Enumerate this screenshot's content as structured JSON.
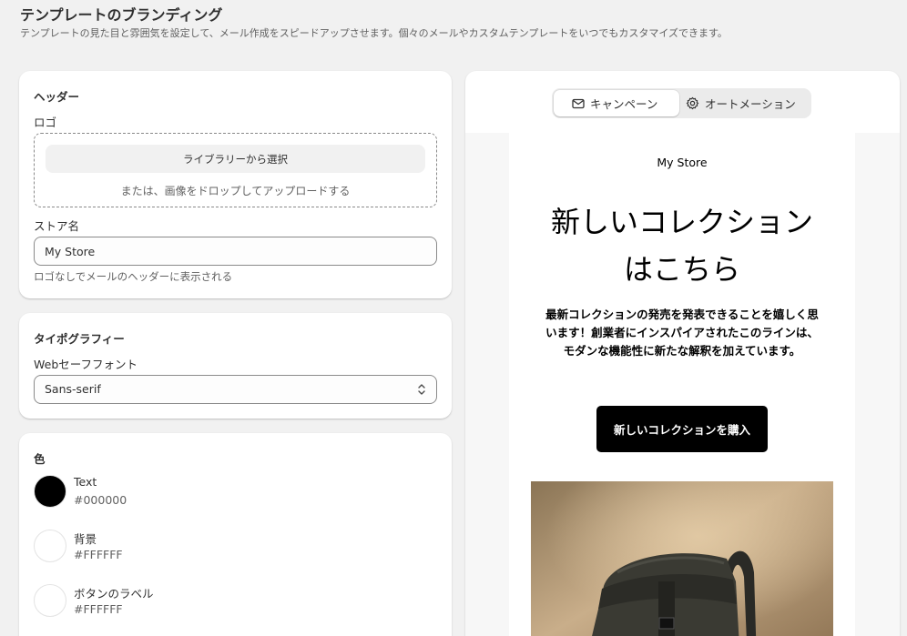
{
  "page": {
    "title": "テンプレートのブランディング",
    "description": "テンプレートの見た目と雰囲気を設定して、メール作成をスピードアップさせます。個々のメールやカスタムテンプレートをいつでもカスタマイズできます。"
  },
  "header_section": {
    "title": "ヘッダー",
    "logo_label": "ロゴ",
    "library_button": "ライブラリーから選択",
    "drop_hint": "または、画像をドロップしてアップロードする",
    "store_name_label": "ストア名",
    "store_name_value": "My Store",
    "store_name_help": "ロゴなしでメールのヘッダーに表示される"
  },
  "typography": {
    "title": "タイポグラフィー",
    "font_label": "Webセーフフォント",
    "font_value": "Sans-serif"
  },
  "colors": {
    "title": "色",
    "items": [
      {
        "name": "Text",
        "hex": "#000000"
      },
      {
        "name": "背景",
        "hex": "#FFFFFF"
      },
      {
        "name": "ボタンのラベル",
        "hex": "#FFFFFF"
      }
    ]
  },
  "preview": {
    "tabs": [
      {
        "label": "キャンペーン",
        "icon": "mail-icon",
        "active": true
      },
      {
        "label": "オートメーション",
        "icon": "gear-icon",
        "active": false
      }
    ],
    "store_name": "My Store",
    "headline": "新しいコレクションはこちら",
    "body": "最新コレクションの発売を発表できることを嬉しく思います！創業者にインスパイアされたこのラインは、モダンな機能性に新たな解釈を加えています。",
    "cta": "新しいコレクションを購入"
  }
}
